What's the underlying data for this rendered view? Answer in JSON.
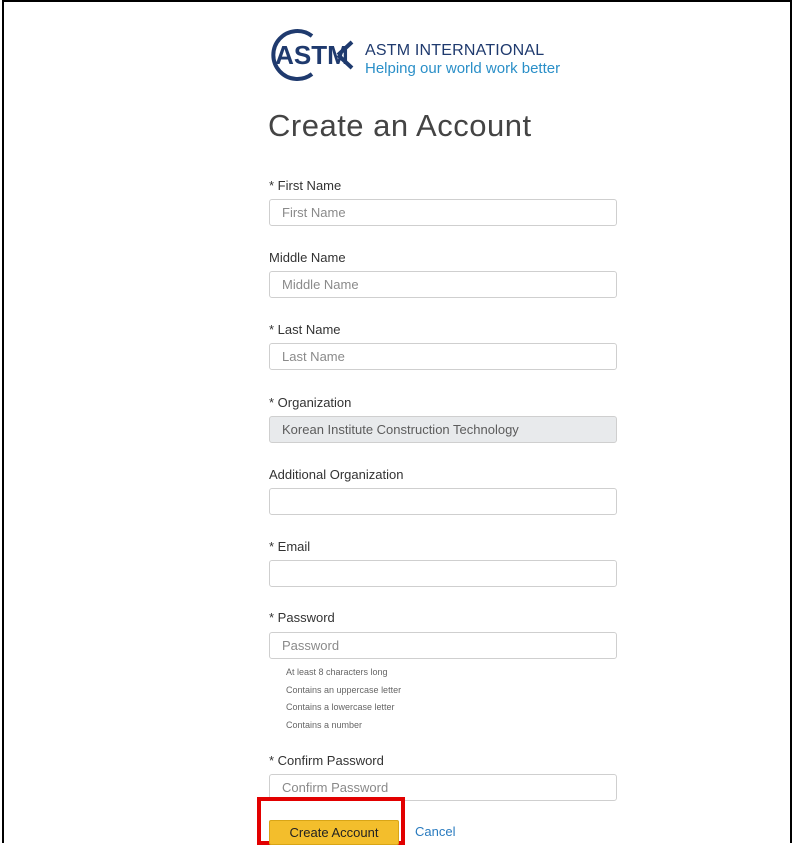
{
  "brand": {
    "name": "ASTM INTERNATIONAL",
    "tagline": "Helping our world work better",
    "logo_text": "ASTM",
    "primary_color": "#1f3a6e",
    "accent_color": "#2a8fc8"
  },
  "page": {
    "title": "Create an Account"
  },
  "form": {
    "first_name": {
      "label": "* First Name",
      "placeholder": "First Name",
      "value": ""
    },
    "middle_name": {
      "label": "Middle Name",
      "placeholder": "Middle Name",
      "value": ""
    },
    "last_name": {
      "label": "* Last Name",
      "placeholder": "Last Name",
      "value": ""
    },
    "organization": {
      "label": "* Organization",
      "value": "Korean Institute Construction Technology"
    },
    "additional_organization": {
      "label": "Additional Organization",
      "value": ""
    },
    "email": {
      "label": "* Email",
      "value": ""
    },
    "password": {
      "label": "* Password",
      "placeholder": "Password",
      "requirements": [
        "At least 8 characters long",
        "Contains an uppercase letter",
        "Contains a lowercase letter",
        "Contains a number"
      ]
    },
    "confirm_password": {
      "label": "* Confirm Password",
      "placeholder": "Confirm Password"
    }
  },
  "actions": {
    "create_label": "Create Account",
    "cancel_label": "Cancel",
    "create_color": "#f3be2c",
    "highlight_color": "#e20000"
  }
}
